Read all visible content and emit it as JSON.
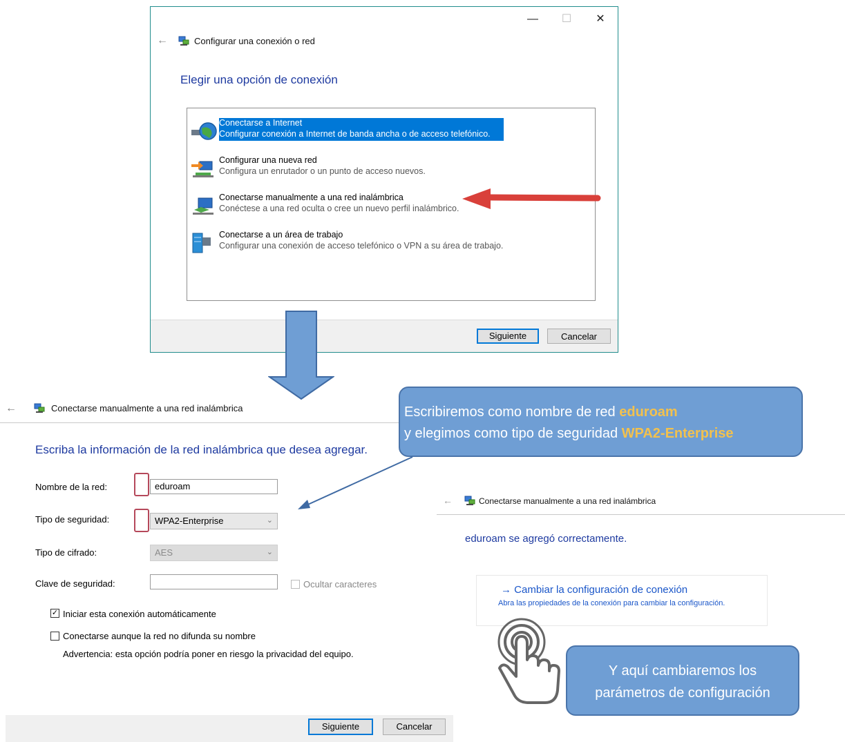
{
  "window1": {
    "title": "Configurar una conexión o red",
    "heading": "Elegir una opción de conexión",
    "options": [
      {
        "title": "Conectarse a Internet",
        "desc": "Configurar conexión a Internet de banda ancha o de acceso telefónico.",
        "icon": "globe-network-icon"
      },
      {
        "title": "Configurar una nueva red",
        "desc": "Configura un enrutador o un punto de acceso nuevos.",
        "icon": "new-network-icon"
      },
      {
        "title": "Conectarse manualmente a una red inalámbrica",
        "desc": "Conéctese a una red oculta o cree un nuevo perfil inalámbrico.",
        "icon": "wireless-network-icon"
      },
      {
        "title": "Conectarse a un área de trabajo",
        "desc": "Configurar una conexión de acceso telefónico o VPN a su área de trabajo.",
        "icon": "workplace-icon"
      }
    ],
    "next_label": "Siguiente",
    "cancel_label": "Cancelar"
  },
  "window2": {
    "title": "Conectarse manualmente a una red inalámbrica",
    "heading": "Escriba la información de la red inalámbrica que desea agregar.",
    "network_name_label": "Nombre de la red:",
    "network_name_value": "eduroam",
    "security_type_label": "Tipo de seguridad:",
    "security_type_value": "WPA2-Enterprise",
    "encryption_label": "Tipo de cifrado:",
    "encryption_value": "AES",
    "security_key_label": "Clave de seguridad:",
    "hide_chars_label": "Ocultar caracteres",
    "auto_connect_label": "Iniciar esta conexión automáticamente",
    "auto_connect_checked": true,
    "connect_hidden_label": "Conectarse aunque la red no difunda su nombre",
    "connect_hidden_checked": false,
    "warning": "Advertencia: esta opción podría poner en riesgo la privacidad del equipo.",
    "next_label": "Siguiente",
    "cancel_label": "Cancelar"
  },
  "window3": {
    "title": "Conectarse manualmente a una red inalámbrica",
    "success": "eduroam se agregó correctamente.",
    "link_title": "Cambiar la configuración de conexión",
    "link_desc": "Abra las propiedades de la conexión para cambiar la configuración."
  },
  "callout1": {
    "line1_prefix": "Escribiremos como nombre de red ",
    "line1_highlight": "eduroam",
    "line2_prefix": "y elegimos como tipo de seguridad ",
    "line2_highlight": "WPA2-Enterprise"
  },
  "callout2": {
    "line1": "Y aquí cambiaremos los",
    "line2": "parámetros de configuración"
  },
  "colors": {
    "selection": "#0078d7",
    "heading": "#1e3aa0",
    "arrow_red": "#d9403a",
    "arrow_blue": "#6f9ed4",
    "callout_highlight": "#f2c14e"
  }
}
